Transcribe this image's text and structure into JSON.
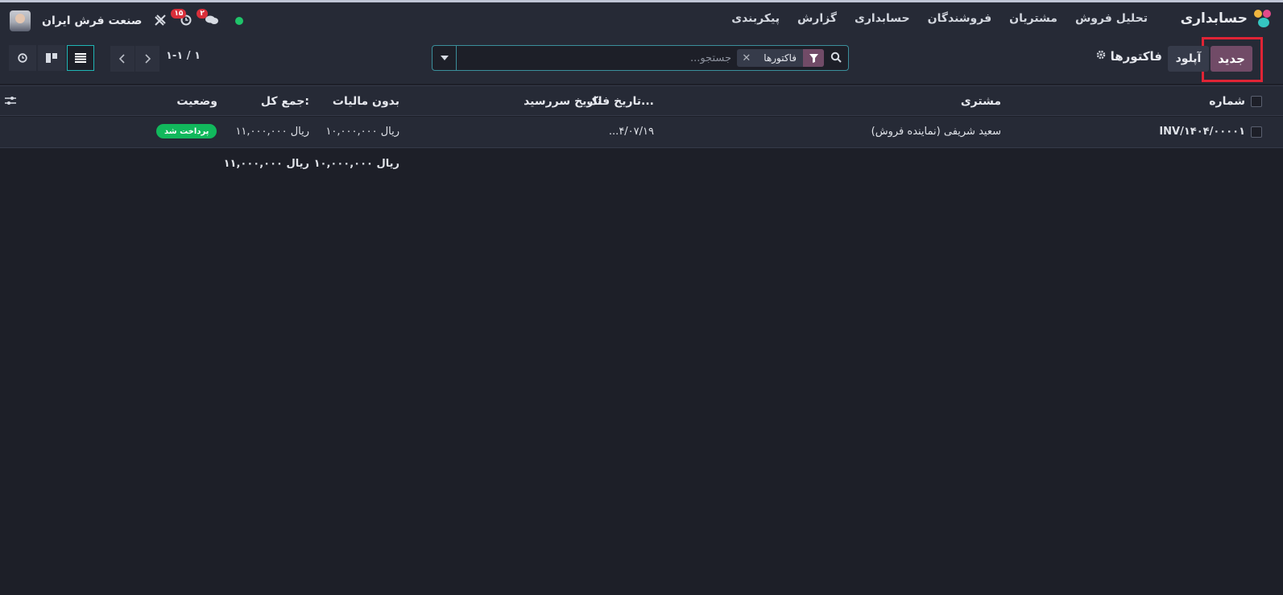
{
  "app": {
    "title": "حسابداری",
    "menu": [
      "تحلیل فروش",
      "مشتریان",
      "فروشندگان",
      "حسابداری",
      "گزارش",
      "پیکربندی"
    ],
    "company": "صنعت فرش ایران",
    "activity_badge": "۱۵",
    "messages_badge": "۲"
  },
  "control": {
    "new_label": "جدید",
    "upload_label": "آپلود",
    "breadcrumb": "فاکتورها"
  },
  "search": {
    "facet": "فاکتورها",
    "placeholder": "جستجو..."
  },
  "pager": {
    "value": "۱-۱ / ۱"
  },
  "table": {
    "headers": {
      "number": "شماره",
      "customer": "مشتری",
      "invoice_date": "تاریخ فاک...",
      "due_date": "تاریخ سررسید",
      "untaxed": "بدون مالیات",
      "total": "جمع کل:",
      "status": "وضعیت"
    },
    "rows": [
      {
        "number": "INV/۱۴۰۴/۰۰۰۰۱",
        "customer": "سعید شریفی (نماینده فروش)",
        "invoice_date": "...۴/۰۷/۱۹",
        "due_date": "",
        "untaxed": "ریال ۱۰,۰۰۰,۰۰۰",
        "total": "ریال ۱۱,۰۰۰,۰۰۰",
        "status": "پرداخت شد"
      }
    ],
    "footer": {
      "untaxed": "ریال ۱۰,۰۰۰,۰۰۰",
      "total": "ریال ۱۱,۰۰۰,۰۰۰"
    }
  },
  "colors": {
    "primary": "#714b67",
    "accent": "#1fb5b5",
    "paid": "#11b85c",
    "highlight": "#e02435"
  }
}
